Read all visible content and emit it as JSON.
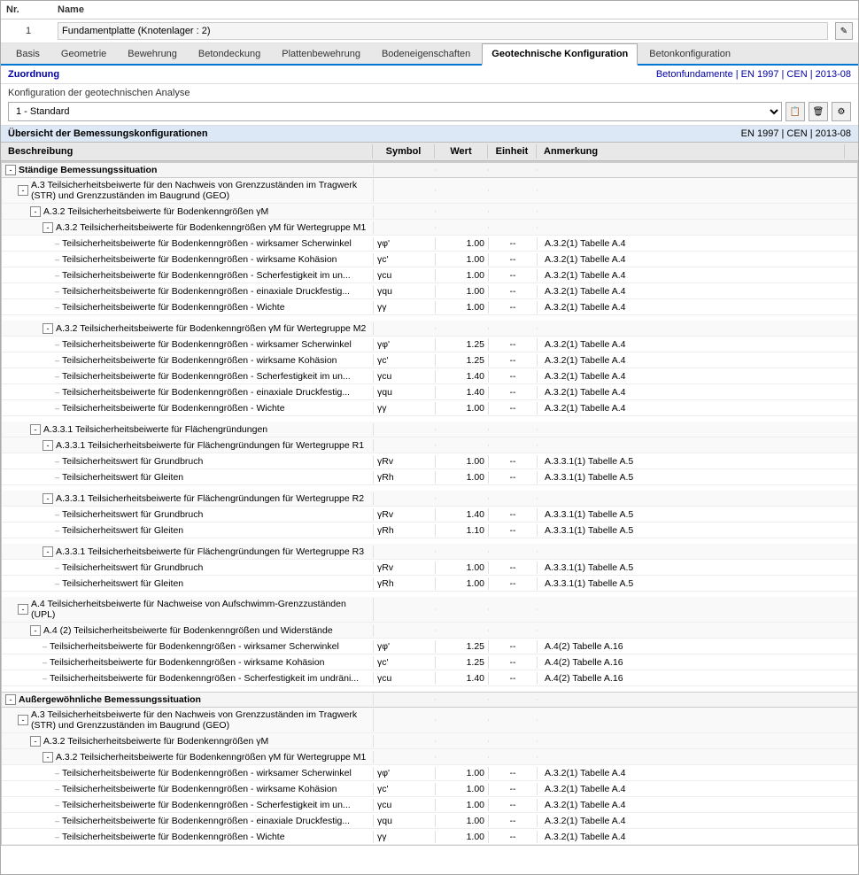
{
  "header": {
    "nr_label": "Nr.",
    "name_label": "Name",
    "row_nr": "1",
    "row_name": "Fundamentplatte (Knotenlager : 2)"
  },
  "tabs": [
    {
      "id": "basis",
      "label": "Basis"
    },
    {
      "id": "geometrie",
      "label": "Geometrie"
    },
    {
      "id": "bewehrung",
      "label": "Bewehrung"
    },
    {
      "id": "betondeckung",
      "label": "Betondeckung"
    },
    {
      "id": "plattenbewehrung",
      "label": "Plattenbewehrung"
    },
    {
      "id": "bodeneigenschaften",
      "label": "Bodeneigenschaften"
    },
    {
      "id": "geotechnische",
      "label": "Geotechnische Konfiguration",
      "active": true
    },
    {
      "id": "betonkonfiguration",
      "label": "Betonkonfiguration"
    }
  ],
  "zuordnung": {
    "label": "Zuordnung",
    "right": "Betonfundamente | EN 1997 | CEN | 2013-08"
  },
  "config": {
    "label": "Konfiguration der geotechnischen Analyse",
    "select_value": "1 - Standard",
    "icons": [
      "copy",
      "delete",
      "settings"
    ]
  },
  "overview": {
    "title": "Übersicht der Bemessungskonfigurationen",
    "right": "EN 1997 | CEN | 2013-08"
  },
  "table_headers": {
    "beschreibung": "Beschreibung",
    "symbol": "Symbol",
    "wert": "Wert",
    "einheit": "Einheit",
    "anmerkung": "Anmerkung"
  },
  "rows": [
    {
      "type": "section",
      "indent": 0,
      "expand": "-",
      "label": "Ständige Bemessungssituation",
      "sym": "",
      "val": "",
      "unit": "",
      "note": ""
    },
    {
      "type": "group",
      "indent": 1,
      "expand": "-",
      "label": "A.3 Teilsicherheitsbeiwerte für den Nachweis von Grenzzuständen im Tragwerk (STR) und Grenzzuständen im Baugrund (GEO)",
      "sym": "",
      "val": "",
      "unit": "",
      "note": ""
    },
    {
      "type": "group",
      "indent": 2,
      "expand": "-",
      "label": "A.3.2 Teilsicherheitsbeiwerte für Bodenkenngrößen γM",
      "sym": "",
      "val": "",
      "unit": "",
      "note": ""
    },
    {
      "type": "group",
      "indent": 3,
      "expand": "-",
      "label": "A.3.2 Teilsicherheitsbeiwerte für Bodenkenngrößen γM für Wertegruppe M1",
      "sym": "",
      "val": "",
      "unit": "",
      "note": ""
    },
    {
      "type": "leaf",
      "indent": 4,
      "label": "Teilsicherheitsbeiwerte für Bodenkenngrößen - wirksamer Scherwinkel",
      "sym": "γφ'",
      "val": "1.00",
      "unit": "--",
      "note": "A.3.2(1) Tabelle A.4"
    },
    {
      "type": "leaf",
      "indent": 4,
      "label": "Teilsicherheitsbeiwerte für Bodenkenngrößen - wirksame Kohäsion",
      "sym": "γc'",
      "val": "1.00",
      "unit": "--",
      "note": "A.3.2(1) Tabelle A.4"
    },
    {
      "type": "leaf",
      "indent": 4,
      "label": "Teilsicherheitsbeiwerte für Bodenkenngrößen - Scherfestigkeit im un...",
      "sym": "γcu",
      "val": "1.00",
      "unit": "--",
      "note": "A.3.2(1) Tabelle A.4"
    },
    {
      "type": "leaf",
      "indent": 4,
      "label": "Teilsicherheitsbeiwerte für Bodenkenngrößen - einaxiale Druckfestig...",
      "sym": "γqu",
      "val": "1.00",
      "unit": "--",
      "note": "A.3.2(1) Tabelle A.4"
    },
    {
      "type": "leaf",
      "indent": 4,
      "label": "Teilsicherheitsbeiwerte für Bodenkenngrößen - Wichte",
      "sym": "γγ",
      "val": "1.00",
      "unit": "--",
      "note": "A.3.2(1) Tabelle A.4"
    },
    {
      "type": "spacer"
    },
    {
      "type": "group",
      "indent": 3,
      "expand": "-",
      "label": "A.3.2 Teilsicherheitsbeiwerte für Bodenkenngrößen γM für Wertegruppe M2",
      "sym": "",
      "val": "",
      "unit": "",
      "note": ""
    },
    {
      "type": "leaf",
      "indent": 4,
      "label": "Teilsicherheitsbeiwerte für Bodenkenngrößen - wirksamer Scherwinkel",
      "sym": "γφ'",
      "val": "1.25",
      "unit": "--",
      "note": "A.3.2(1) Tabelle A.4"
    },
    {
      "type": "leaf",
      "indent": 4,
      "label": "Teilsicherheitsbeiwerte für Bodenkenngrößen - wirksame Kohäsion",
      "sym": "γc'",
      "val": "1.25",
      "unit": "--",
      "note": "A.3.2(1) Tabelle A.4"
    },
    {
      "type": "leaf",
      "indent": 4,
      "label": "Teilsicherheitsbeiwerte für Bodenkenngrößen - Scherfestigkeit im un...",
      "sym": "γcu",
      "val": "1.40",
      "unit": "--",
      "note": "A.3.2(1) Tabelle A.4"
    },
    {
      "type": "leaf",
      "indent": 4,
      "label": "Teilsicherheitsbeiwerte für Bodenkenngrößen - einaxiale Druckfestig...",
      "sym": "γqu",
      "val": "1.40",
      "unit": "--",
      "note": "A.3.2(1) Tabelle A.4"
    },
    {
      "type": "leaf",
      "indent": 4,
      "label": "Teilsicherheitsbeiwerte für Bodenkenngrößen - Wichte",
      "sym": "γγ",
      "val": "1.00",
      "unit": "--",
      "note": "A.3.2(1) Tabelle A.4"
    },
    {
      "type": "spacer"
    },
    {
      "type": "group",
      "indent": 2,
      "expand": "-",
      "label": "A.3.3.1 Teilsicherheitsbeiwerte für Flächengründungen",
      "sym": "",
      "val": "",
      "unit": "",
      "note": ""
    },
    {
      "type": "group",
      "indent": 3,
      "expand": "-",
      "label": "A.3.3.1 Teilsicherheitsbeiwerte für Flächengründungen für Wertegruppe R1",
      "sym": "",
      "val": "",
      "unit": "",
      "note": ""
    },
    {
      "type": "leaf",
      "indent": 4,
      "label": "Teilsicherheitswert für Grundbruch",
      "sym": "γRv",
      "val": "1.00",
      "unit": "--",
      "note": "A.3.3.1(1) Tabelle A.5"
    },
    {
      "type": "leaf",
      "indent": 4,
      "label": "Teilsicherheitswert für Gleiten",
      "sym": "γRh",
      "val": "1.00",
      "unit": "--",
      "note": "A.3.3.1(1) Tabelle A.5"
    },
    {
      "type": "spacer"
    },
    {
      "type": "group",
      "indent": 3,
      "expand": "-",
      "label": "A.3.3.1 Teilsicherheitsbeiwerte für Flächengründungen für Wertegruppe R2",
      "sym": "",
      "val": "",
      "unit": "",
      "note": ""
    },
    {
      "type": "leaf",
      "indent": 4,
      "label": "Teilsicherheitswert für Grundbruch",
      "sym": "γRv",
      "val": "1.40",
      "unit": "--",
      "note": "A.3.3.1(1) Tabelle A.5"
    },
    {
      "type": "leaf",
      "indent": 4,
      "label": "Teilsicherheitswert für Gleiten",
      "sym": "γRh",
      "val": "1.10",
      "unit": "--",
      "note": "A.3.3.1(1) Tabelle A.5"
    },
    {
      "type": "spacer"
    },
    {
      "type": "group",
      "indent": 3,
      "expand": "-",
      "label": "A.3.3.1 Teilsicherheitsbeiwerte für Flächengründungen für Wertegruppe R3",
      "sym": "",
      "val": "",
      "unit": "",
      "note": ""
    },
    {
      "type": "leaf",
      "indent": 4,
      "label": "Teilsicherheitswert für Grundbruch",
      "sym": "γRv",
      "val": "1.00",
      "unit": "--",
      "note": "A.3.3.1(1) Tabelle A.5"
    },
    {
      "type": "leaf",
      "indent": 4,
      "label": "Teilsicherheitswert für Gleiten",
      "sym": "γRh",
      "val": "1.00",
      "unit": "--",
      "note": "A.3.3.1(1) Tabelle A.5"
    },
    {
      "type": "spacer"
    },
    {
      "type": "group",
      "indent": 1,
      "expand": "-",
      "label": "A.4 Teilsicherheitsbeiwerte für Nachweise von Aufschwimm-Grenzzuständen (UPL)",
      "sym": "",
      "val": "",
      "unit": "",
      "note": ""
    },
    {
      "type": "group",
      "indent": 2,
      "expand": "-",
      "label": "A.4 (2) Teilsicherheitsbeiwerte für Bodenkenngrößen und Widerstände",
      "sym": "",
      "val": "",
      "unit": "",
      "note": ""
    },
    {
      "type": "leaf",
      "indent": 3,
      "label": "Teilsicherheitsbeiwerte für Bodenkenngrößen - wirksamer Scherwinkel",
      "sym": "γφ'",
      "val": "1.25",
      "unit": "--",
      "note": "A.4(2) Tabelle A.16"
    },
    {
      "type": "leaf",
      "indent": 3,
      "label": "Teilsicherheitsbeiwerte für Bodenkenngrößen - wirksame Kohäsion",
      "sym": "γc'",
      "val": "1.25",
      "unit": "--",
      "note": "A.4(2) Tabelle A.16"
    },
    {
      "type": "leaf",
      "indent": 3,
      "label": "Teilsicherheitsbeiwerte für Bodenkenngrößen - Scherfestigkeit im undräni...",
      "sym": "γcu",
      "val": "1.40",
      "unit": "--",
      "note": "A.4(2) Tabelle A.16"
    },
    {
      "type": "spacer"
    },
    {
      "type": "section",
      "indent": 0,
      "expand": "-",
      "label": "Außergewöhnliche Bemessungssituation",
      "sym": "",
      "val": "",
      "unit": "",
      "note": ""
    },
    {
      "type": "group",
      "indent": 1,
      "expand": "-",
      "label": "A.3 Teilsicherheitsbeiwerte für den Nachweis von Grenzzuständen im Tragwerk (STR) und Grenzzuständen im Baugrund (GEO)",
      "sym": "",
      "val": "",
      "unit": "",
      "note": ""
    },
    {
      "type": "group",
      "indent": 2,
      "expand": "-",
      "label": "A.3.2 Teilsicherheitsbeiwerte für Bodenkenngrößen γM",
      "sym": "",
      "val": "",
      "unit": "",
      "note": ""
    },
    {
      "type": "group",
      "indent": 3,
      "expand": "-",
      "label": "A.3.2 Teilsicherheitsbeiwerte für Bodenkenngrößen γM für Wertegruppe M1",
      "sym": "",
      "val": "",
      "unit": "",
      "note": ""
    },
    {
      "type": "leaf",
      "indent": 4,
      "label": "Teilsicherheitsbeiwerte für Bodenkenngrößen - wirksamer Scherwinkel",
      "sym": "γφ'",
      "val": "1.00",
      "unit": "--",
      "note": "A.3.2(1) Tabelle A.4"
    },
    {
      "type": "leaf",
      "indent": 4,
      "label": "Teilsicherheitsbeiwerte für Bodenkenngrößen - wirksame Kohäsion",
      "sym": "γc'",
      "val": "1.00",
      "unit": "--",
      "note": "A.3.2(1) Tabelle A.4"
    },
    {
      "type": "leaf",
      "indent": 4,
      "label": "Teilsicherheitsbeiwerte für Bodenkenngrößen - Scherfestigkeit im un...",
      "sym": "γcu",
      "val": "1.00",
      "unit": "--",
      "note": "A.3.2(1) Tabelle A.4"
    },
    {
      "type": "leaf",
      "indent": 4,
      "label": "Teilsicherheitsbeiwerte für Bodenkenngrößen - einaxiale Druckfestig...",
      "sym": "γqu",
      "val": "1.00",
      "unit": "--",
      "note": "A.3.2(1) Tabelle A.4"
    },
    {
      "type": "leaf",
      "indent": 4,
      "label": "Teilsicherheitsbeiwerte für Bodenkenngrößen - Wichte",
      "sym": "γγ",
      "val": "1.00",
      "unit": "--",
      "note": "A.3.2(1) Tabelle A.4"
    }
  ]
}
